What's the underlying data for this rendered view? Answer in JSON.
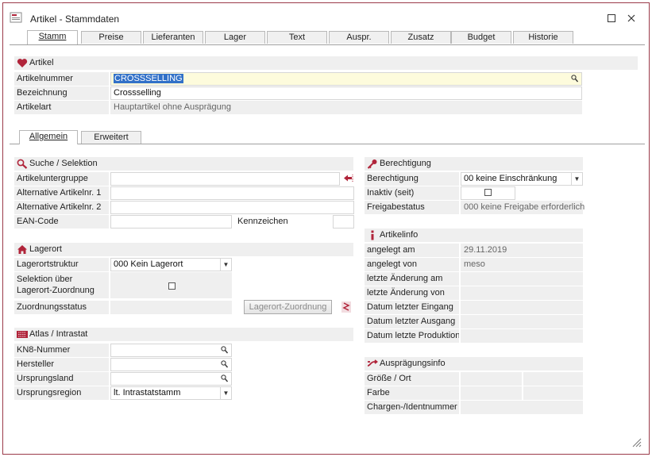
{
  "window": {
    "title": "Artikel - Stammdaten"
  },
  "tabs": [
    {
      "label": "Stamm"
    },
    {
      "label": "Preise"
    },
    {
      "label": "Lieferanten"
    },
    {
      "label": "Lager"
    },
    {
      "label": "Text"
    },
    {
      "label": "Auspr."
    },
    {
      "label": "Zusatz"
    },
    {
      "label": "Budget"
    },
    {
      "label": "Historie"
    }
  ],
  "artikel": {
    "header": "Artikel",
    "artikelnummer_label": "Artikelnummer",
    "artikelnummer_value": "CROSSSELLING",
    "bezeichnung_label": "Bezeichnung",
    "bezeichnung_value": "Crossselling",
    "artikelart_label": "Artikelart",
    "artikelart_value": "Hauptartikel ohne Ausprägung"
  },
  "subtabs": [
    {
      "label": "Allgemein"
    },
    {
      "label": "Erweitert"
    }
  ],
  "suche": {
    "header": "Suche / Selektion",
    "artikeluntergruppe": "Artikeluntergruppe",
    "alt1": "Alternative Artikelnr. 1",
    "alt2": "Alternative Artikelnr. 2",
    "ean": "EAN-Code",
    "kennzeichen": "Kennzeichen"
  },
  "lagerort": {
    "header": "Lagerort",
    "struktur_label": "Lagerortstruktur",
    "struktur_value": "000 Kein Lagerort",
    "selektion_label_1": "Selektion über",
    "selektion_label_2": "Lagerort-Zuordnung",
    "zuordnungsstatus": "Zuordnungsstatus",
    "zuordnung_button": "Lagerort-Zuordnung"
  },
  "atlas": {
    "header": "Atlas / Intrastat",
    "kn8": "KN8-Nummer",
    "hersteller": "Hersteller",
    "ursprungsland": "Ursprungsland",
    "ursprungsregion": "Ursprungsregion",
    "ursprungsregion_value": "lt. Intrastatstamm"
  },
  "berechtigung": {
    "header": "Berechtigung",
    "berechtigung_label": "Berechtigung",
    "berechtigung_value": "00 keine Einschränkung",
    "inaktiv_label": "Inaktiv (seit)",
    "freigabe_label": "Freigabestatus",
    "freigabe_value": "000 keine Freigabe erforderlich"
  },
  "artikelinfo": {
    "header": "Artikelinfo",
    "angelegt_am_label": "angelegt am",
    "angelegt_am_value": "29.11.2019",
    "angelegt_von_label": "angelegt von",
    "angelegt_von_value": "meso",
    "letzte_aenderung_am": "letzte Änderung am",
    "letzte_aenderung_von": "letzte Änderung von",
    "datum_eingang": "Datum letzter Eingang",
    "datum_ausgang": "Datum letzter Ausgang",
    "datum_produktion": "Datum letzte Produktion"
  },
  "auspraegungsinfo": {
    "header": "Ausprägungsinfo",
    "groesse": "Größe / Ort",
    "farbe": "Farbe",
    "chargen": "Chargen-/Identnummer"
  },
  "colors": {
    "accent": "#b0243a",
    "selection": "#3271c8",
    "highlight_field": "#fdfbdc"
  },
  "icons": [
    "app-icon",
    "minimize-icon",
    "maximize-icon",
    "close-icon",
    "heart-icon",
    "search-icon",
    "house-icon",
    "key-icon",
    "info-icon",
    "shuffle-icon",
    "atlas-icon",
    "magnifier-icon",
    "arrow-left-icon",
    "resize-grip-icon"
  ]
}
